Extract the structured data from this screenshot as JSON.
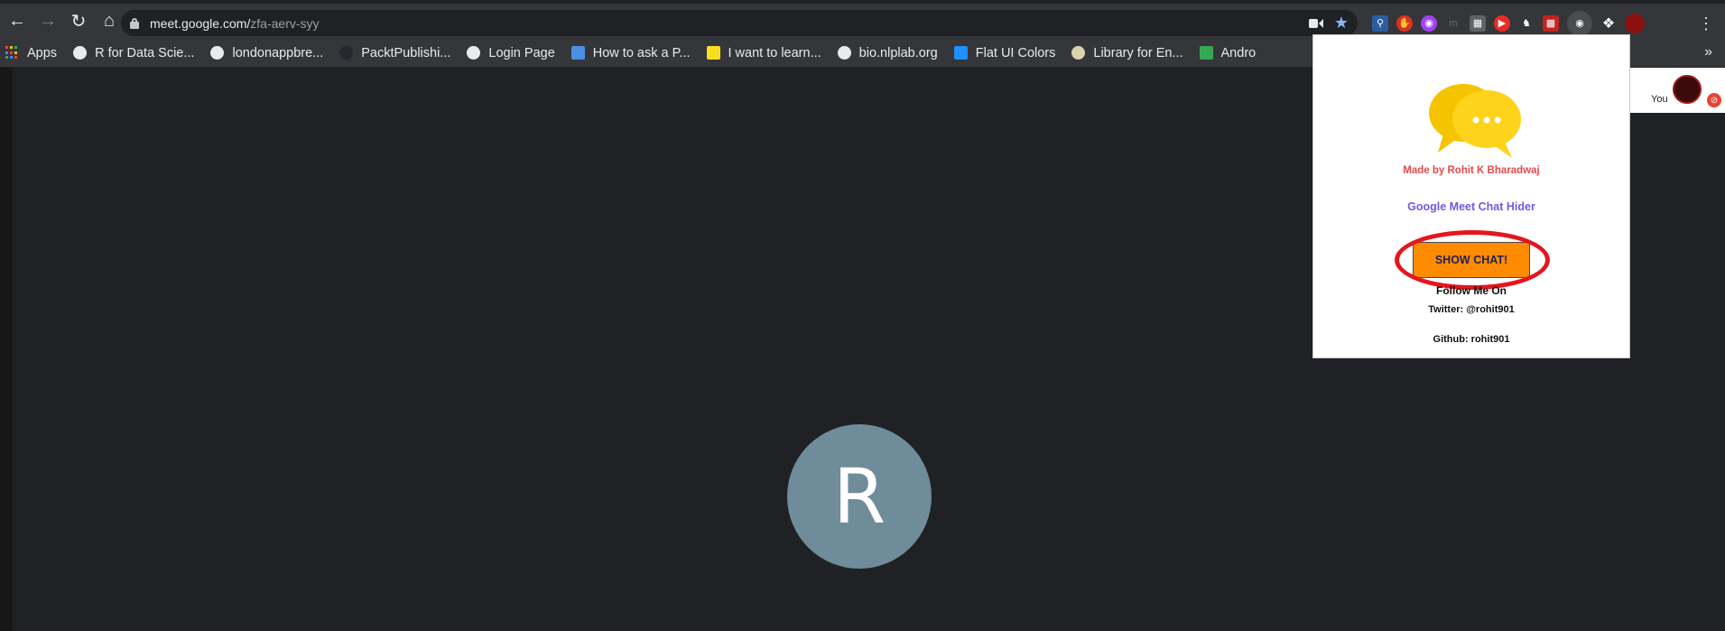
{
  "browser": {
    "url_host": "meet.google.com/",
    "url_path": "zfa-aerv-syy"
  },
  "bookmarks": [
    {
      "label": "Apps",
      "icon": "apps-grid-icon"
    },
    {
      "label": "R for Data Scie...",
      "icon": "globe-icon"
    },
    {
      "label": "londonappbre...",
      "icon": "github-icon"
    },
    {
      "label": "PacktPublishi...",
      "icon": "github-icon"
    },
    {
      "label": "Login Page",
      "icon": "globe-icon"
    },
    {
      "label": "How to ask a P...",
      "icon": "blue-square-icon"
    },
    {
      "label": "I want to learn...",
      "icon": "d-icon"
    },
    {
      "label": "bio.nlplab.org",
      "icon": "globe-icon"
    },
    {
      "label": "Flat UI Colors",
      "icon": "flat-ui-icon"
    },
    {
      "label": "Library for En...",
      "icon": "ml-icon"
    },
    {
      "label": "Andro",
      "icon": "drive-icon"
    }
  ],
  "meet": {
    "participant_initial": "R",
    "self_label": "You"
  },
  "popup": {
    "made_by": "Made by Rohit K Bharadwaj",
    "app_name": "Google Meet Chat Hider",
    "button_label": "SHOW CHAT!",
    "follow": "Follow Me On",
    "twitter": "Twitter: @rohit901",
    "github": "Github: rohit901"
  },
  "colors": {
    "button": "#ff8c00",
    "annotation_circle": "#e8141c",
    "made_by": "#e24a4a",
    "app_name": "#6c5ce7",
    "avatar": "#6e8c99"
  }
}
